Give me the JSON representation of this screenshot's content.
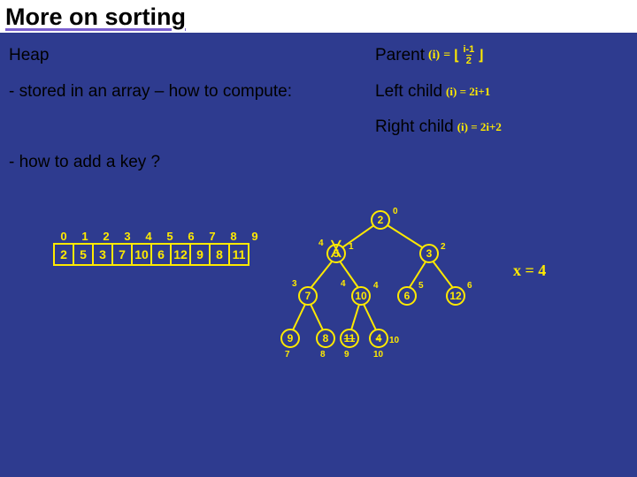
{
  "title": "More on sorting",
  "left": {
    "heap": "Heap",
    "stored": "- stored in an array – how to compute:",
    "addkey": "- how to add a key ?"
  },
  "right": {
    "parent": "Parent",
    "parent_formula_i": "(i)",
    "parent_eq": "=",
    "parent_num": "i-1",
    "parent_den": "2",
    "leftchild": "Left child",
    "leftchild_formula": "(i) = 2i+1",
    "rightchild": "Right child",
    "rightchild_formula": "(i) = 2i+2"
  },
  "array": {
    "indices": [
      "0",
      "1",
      "2",
      "3",
      "4",
      "5",
      "6",
      "7",
      "8",
      "9"
    ],
    "values": [
      "2",
      "5",
      "3",
      "7",
      "10",
      "6",
      "12",
      "9",
      "8",
      "11"
    ]
  },
  "xnote": "x = 4",
  "chart_data": {
    "type": "table",
    "array_indices": [
      0,
      1,
      2,
      3,
      4,
      5,
      6,
      7,
      8,
      9
    ],
    "array_values": [
      2,
      5,
      3,
      7,
      10,
      6,
      12,
      9,
      8,
      11
    ],
    "tree_nodes": [
      {
        "id": 0,
        "value": 2,
        "parent": null
      },
      {
        "id": 1,
        "value": 5,
        "parent": 0,
        "slash": true,
        "insert_value": 4
      },
      {
        "id": 2,
        "value": 3,
        "parent": 0
      },
      {
        "id": 3,
        "value": 7,
        "parent": 1,
        "slash": true
      },
      {
        "id": 4,
        "value": 10,
        "parent": 1,
        "insert_value": 4
      },
      {
        "id": 5,
        "value": 6,
        "parent": 2
      },
      {
        "id": 6,
        "value": 12,
        "parent": 2
      },
      {
        "id": 7,
        "value": 9,
        "parent": 3
      },
      {
        "id": 8,
        "value": 8,
        "parent": 3
      },
      {
        "id": 9,
        "value": 11,
        "parent": 4,
        "strike": true,
        "insert_value": 10
      },
      {
        "id": 10,
        "value": 4,
        "parent": 4,
        "new": true,
        "strike": true
      }
    ],
    "inserted_key": 4
  }
}
